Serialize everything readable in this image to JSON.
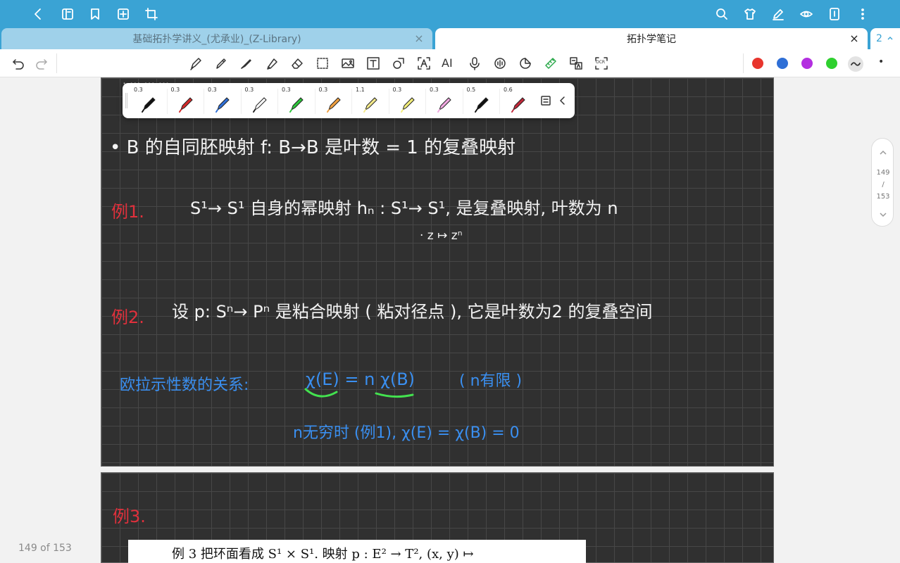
{
  "tabs": {
    "inactive_title": "基础拓扑学讲义_(尤承业)_(Z-Library)",
    "active_title": "拓扑学笔记",
    "close_glyph": "×",
    "tab_count": "2"
  },
  "pen_sizes": [
    "0.3",
    "0.3",
    "0.3",
    "0.3",
    "0.3",
    "0.3",
    "1.1",
    "0.3",
    "0.3",
    "0.5",
    "0.6"
  ],
  "pen_colors": [
    "#111111",
    "#d42a2a",
    "#2f6fd6",
    "#ffffff",
    "#2cc43a",
    "#f0a040",
    "#f3e98a",
    "#f3ee7a",
    "#f0a8e0",
    "#111111",
    "#c0283a"
  ],
  "toolbar": {
    "text_tool_label": "T",
    "ai_label": "AI",
    "ocr_label": "OCR",
    "more_glyph": "•"
  },
  "color_dots": [
    "#e8352d",
    "#2f6fd6",
    "#b32fe0",
    "#2fd02f"
  ],
  "notes": {
    "top_partial": "·  ···  ···  ···",
    "line1": "• B 的自同胚映射 f: B→B 是叶数 = 1 的复叠映射",
    "ex1_label": "例1.",
    "ex1_text": "S¹→ S¹ 自身的幂映射 hₙ : S¹→ S¹,  是复叠映射, 叶数为 n",
    "ex1_map": "·  z ↦ zⁿ",
    "ex2_label": "例2.",
    "ex2_text": "设 p: Sⁿ→ Pⁿ 是粘合映射 ( 粘对径点 ), 它是叶数为2 的复叠空间",
    "euler_label": "欧拉示性数的关系:",
    "euler_formula": "χ(E) = n χ(B)",
    "euler_note": "( n有限 )",
    "infinite_text": "n无穷时 (例1),   χ(E) = χ(B) = 0",
    "ex3_label": "例3."
  },
  "scan_text": "例 3    把环面看成 S¹ × S¹.  映射 p : E² → T², (x, y) ↦",
  "scroller": {
    "current": "149",
    "slash": "/",
    "total": "153"
  },
  "page_counter": "149 of 153"
}
